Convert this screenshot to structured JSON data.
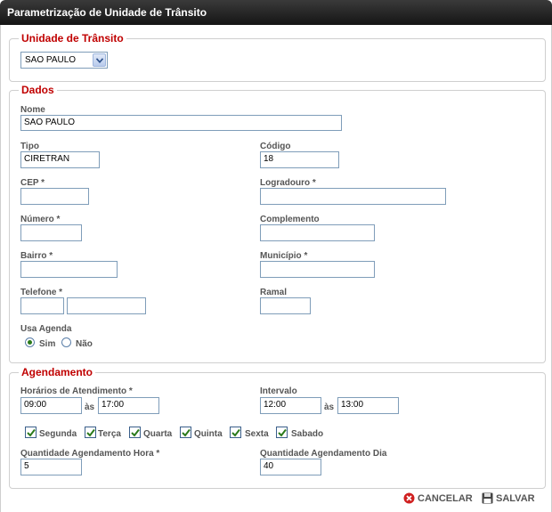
{
  "window": {
    "title": "Parametrização de Unidade de Trânsito"
  },
  "unidade": {
    "legend": "Unidade de Trânsito",
    "selected": "SAO PAULO"
  },
  "dados": {
    "legend": "Dados",
    "nome": {
      "label": "Nome",
      "value": "SAO PAULO"
    },
    "tipo": {
      "label": "Tipo",
      "value": "CIRETRAN"
    },
    "codigo": {
      "label": "Código",
      "value": "18"
    },
    "cep": {
      "label": "CEP *",
      "value": ""
    },
    "logradouro": {
      "label": "Logradouro *",
      "value": ""
    },
    "numero": {
      "label": "Número *",
      "value": ""
    },
    "complemento": {
      "label": "Complemento",
      "value": ""
    },
    "bairro": {
      "label": "Bairro *",
      "value": ""
    },
    "municipio": {
      "label": "Município *",
      "value": ""
    },
    "telefone": {
      "label": "Telefone *",
      "ddd": "",
      "numero": ""
    },
    "ramal": {
      "label": "Ramal",
      "value": ""
    },
    "usa_agenda": {
      "label": "Usa Agenda",
      "option_sim": "Sim",
      "option_nao": "Não",
      "selected": "Sim"
    }
  },
  "agendamento": {
    "legend": "Agendamento",
    "horarios": {
      "label": "Horários de Atendimento *",
      "inicio": "09:00",
      "fim": "17:00",
      "separator": "às"
    },
    "intervalo": {
      "label": "Intervalo",
      "inicio": "12:00",
      "fim": "13:00",
      "separator": "às"
    },
    "dias": {
      "segunda": "Segunda",
      "terca": "Terça",
      "quarta": "Quarta",
      "quinta": "Quinta",
      "sexta": "Sexta",
      "sabado": "Sabado"
    },
    "qtd_hora": {
      "label": "Quantidade Agendamento Hora *",
      "value": "5"
    },
    "qtd_dia": {
      "label": "Quantidade Agendamento Dia",
      "value": "40"
    }
  },
  "actions": {
    "cancelar": "CANCELAR",
    "salvar": "SALVAR"
  },
  "colors": {
    "legend": "#c00000",
    "titlebar": "#1e1e1e",
    "check": "#2a7a1a"
  }
}
